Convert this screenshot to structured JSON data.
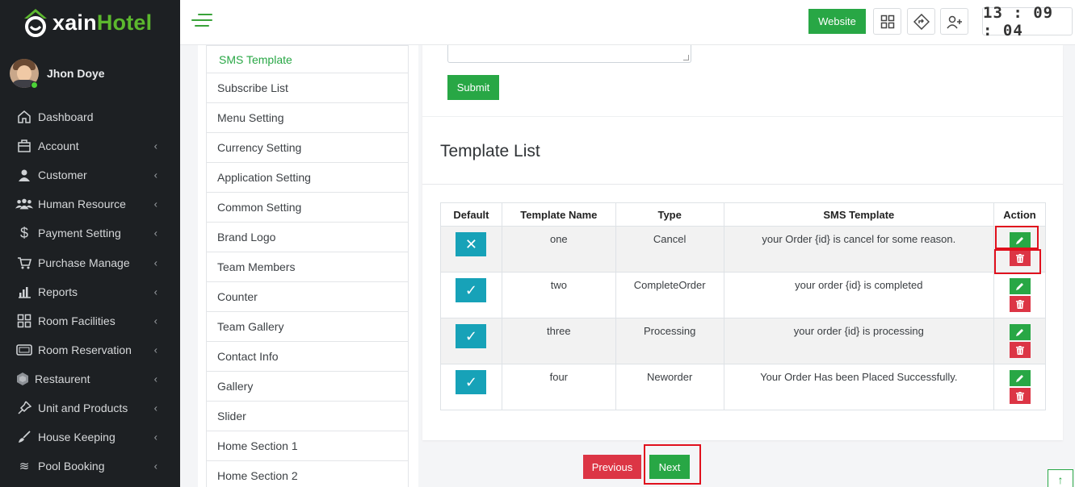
{
  "brand": {
    "name_prefix": "xain",
    "name_suffix": "Hotel"
  },
  "user": {
    "name": "Jhon Doye"
  },
  "sidebar": {
    "items": [
      {
        "label": "Dashboard",
        "icon": "home-icon",
        "has_submenu": false
      },
      {
        "label": "Account",
        "icon": "briefcase-icon",
        "has_submenu": true
      },
      {
        "label": "Customer",
        "icon": "user-icon",
        "has_submenu": true
      },
      {
        "label": "Human Resource",
        "icon": "users-icon",
        "has_submenu": true
      },
      {
        "label": "Payment Setting",
        "icon": "dollar-icon",
        "has_submenu": true
      },
      {
        "label": "Purchase Manage",
        "icon": "cart-icon",
        "has_submenu": true
      },
      {
        "label": "Reports",
        "icon": "bar-chart-icon",
        "has_submenu": true
      },
      {
        "label": "Room Facilities",
        "icon": "grid-icon",
        "has_submenu": true
      },
      {
        "label": "Room Reservation",
        "icon": "tv-icon",
        "has_submenu": true
      },
      {
        "label": "Restaurent",
        "icon": "hexagon-icon",
        "has_submenu": true
      },
      {
        "label": "Unit and Products",
        "icon": "pin-icon",
        "has_submenu": true
      },
      {
        "label": "House Keeping",
        "icon": "brush-icon",
        "has_submenu": true
      },
      {
        "label": "Pool Booking",
        "icon": "waves-icon",
        "has_submenu": true
      }
    ],
    "chevron": "‹"
  },
  "topbar": {
    "website_label": "Website",
    "clock": "13 : 09 : 04"
  },
  "settings_menu": {
    "items": [
      "SMS Template",
      "Subscribe List",
      "Menu Setting",
      "Currency Setting",
      "Application Setting",
      "Common Setting",
      "Brand Logo",
      "Team Members",
      "Counter",
      "Team Gallery",
      "Contact Info",
      "Gallery",
      "Slider",
      "Home Section 1",
      "Home Section 2"
    ],
    "active": "SMS Template"
  },
  "form": {
    "submit_label": "Submit"
  },
  "template_list": {
    "title": "Template List",
    "headers": [
      "Default",
      "Template Name",
      "Type",
      "SMS Template",
      "Action"
    ],
    "rows": [
      {
        "default_icon": "✕",
        "name": "one",
        "type": "Cancel",
        "template": "your Order {id} is cancel for some reason."
      },
      {
        "default_icon": "✓",
        "name": "two",
        "type": "CompleteOrder",
        "template": "your order {id} is completed"
      },
      {
        "default_icon": "✓",
        "name": "three",
        "type": "Processing",
        "template": "your order {id} is processing"
      },
      {
        "default_icon": "✓",
        "name": "four",
        "type": "Neworder",
        "template": "Your Order Has been Placed Successfully."
      }
    ]
  },
  "pagination": {
    "prev_label": "Previous",
    "next_label": "Next"
  },
  "colors": {
    "accent": "#28a745",
    "danger": "#dc3545",
    "info": "#17a2b8",
    "sidebar": "#1d2023",
    "highlight": "#e0101d"
  }
}
